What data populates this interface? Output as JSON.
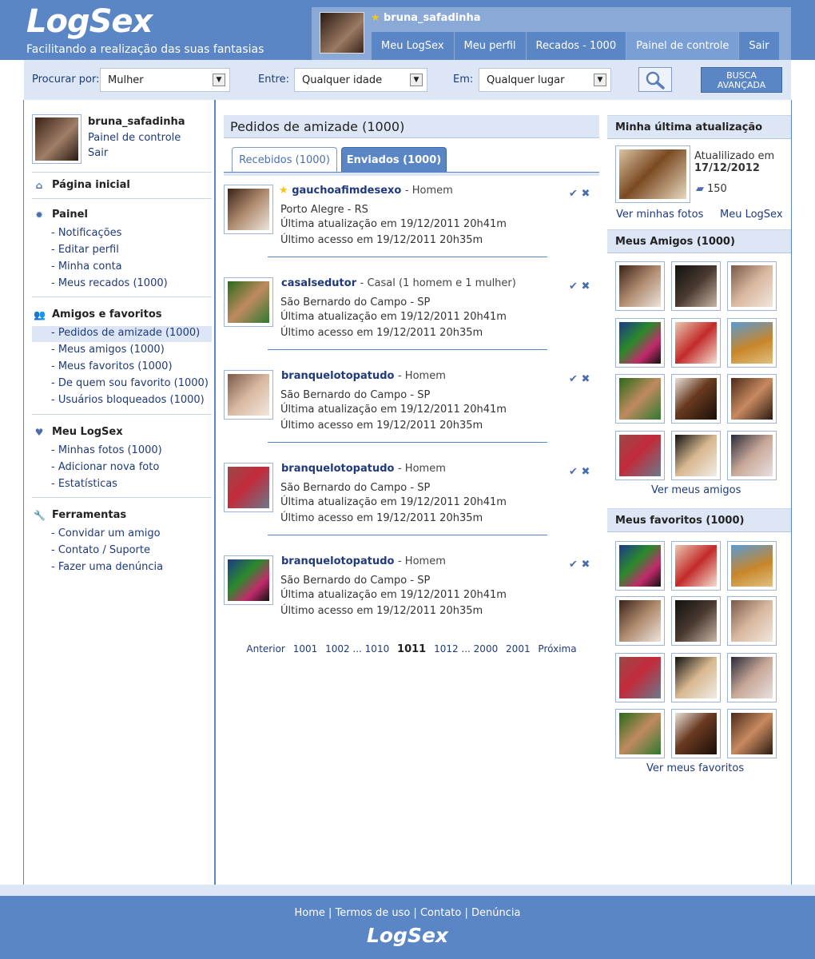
{
  "brand": {
    "logo": "LogSex",
    "tagline": "Facilitando a realização das suas fantasias"
  },
  "user": {
    "name": "bruna_safadinha"
  },
  "topnav": [
    "Meu LogSex",
    "Meu perfil",
    "Recados - 1000",
    "Painel de controle",
    "Sair"
  ],
  "search": {
    "label_search": "Procurar por:",
    "search_value": "Mulher",
    "label_between": "Entre:",
    "between_value": "Qualquer idade",
    "label_in": "Em:",
    "in_value": "Qualquer lugar",
    "advanced_line1": "BUSCA",
    "advanced_line2": "AVANÇADA"
  },
  "sidebar": {
    "profile_name": "bruna_safadinha",
    "profile_panel": "Painel de controle",
    "profile_exit": "Sair",
    "home": "Página inicial",
    "panel": {
      "title": "Painel",
      "items": [
        "- Notificações",
        "- Editar perfil",
        "- Minha conta",
        "- Meus recados (1000)"
      ]
    },
    "friends": {
      "title": "Amigos e favoritos",
      "items": [
        "- Pedidos de amizade (1000)",
        "- Meus amigos (1000)",
        "- Meus favoritos (1000)",
        "- De quem sou favorito (1000)",
        "- Usuários bloqueados (1000)"
      ]
    },
    "mylogsex": {
      "title": "Meu LogSex",
      "items": [
        "- Minhas fotos (1000)",
        "- Adicionar nova foto",
        "- Estatísticas"
      ]
    },
    "tools": {
      "title": "Ferramentas",
      "items": [
        "- Convidar um amigo",
        "- Contato / Suporte",
        "- Fazer uma denúncia"
      ]
    }
  },
  "main": {
    "title": "Pedidos de amizade (1000)",
    "tabs": [
      "Recebidos (1000)",
      "Enviados (1000)"
    ],
    "requests": [
      {
        "name": "gauchoafimdesexo",
        "type": "- Homem",
        "location": "Porto Alegre - RS",
        "updated": "Última atualização em 19/12/2011 20h41m",
        "access": "Último acesso em 19/12/2011 20h35m"
      },
      {
        "name": "casalsedutor",
        "type": "- Casal (1 homem e 1 mulher)",
        "location": "São Bernardo do Campo - SP",
        "updated": "Última atualização em 19/12/2011 20h41m",
        "access": "Último acesso em 19/12/2011 20h35m"
      },
      {
        "name": "branquelotopatudo",
        "type": "- Homem",
        "location": "São Bernardo do Campo - SP",
        "updated": "Última atualização em 19/12/2011 20h41m",
        "access": "Último acesso em 19/12/2011 20h35m"
      },
      {
        "name": "branquelotopatudo",
        "type": "- Homem",
        "location": "São Bernardo do Campo - SP",
        "updated": "Última atualização em 19/12/2011 20h41m",
        "access": "Último acesso em 19/12/2011 20h35m"
      },
      {
        "name": "branquelotopatudo",
        "type": "- Homem",
        "location": "São Bernardo do Campo - SP",
        "updated": "Última atualização em 19/12/2011 20h41m",
        "access": "Último acesso em 19/12/2011 20h35m"
      }
    ],
    "pager": {
      "prev": "Anterior",
      "p1": "1001",
      "p2": "1002 ... 1010",
      "current": "1011",
      "p3": "1012 ... 2000",
      "p4": "2001",
      "next": "Próxima"
    }
  },
  "right": {
    "update_title": "Minha última atualização",
    "update_label": "Atualilizado em",
    "update_date": "17/12/2012",
    "update_comments": "150",
    "link_photos": "Ver minhas fotos",
    "link_mylogsex": "Meu LogSex",
    "friends_title": "Meus Amigos (1000)",
    "friends_link": "Ver meus amigos",
    "favorites_title": "Meus favoritos (1000)",
    "favorites_link": "Ver meus favoritos"
  },
  "footer": {
    "home": "Home",
    "terms": "Termos de uso",
    "contact": "Contato",
    "report": "Denúncia",
    "logo": "LogSex"
  },
  "colors": {
    "primary": "#5b86c6",
    "light": "#dce6f5",
    "link": "#1f3a7a",
    "star": "#f5c518"
  }
}
